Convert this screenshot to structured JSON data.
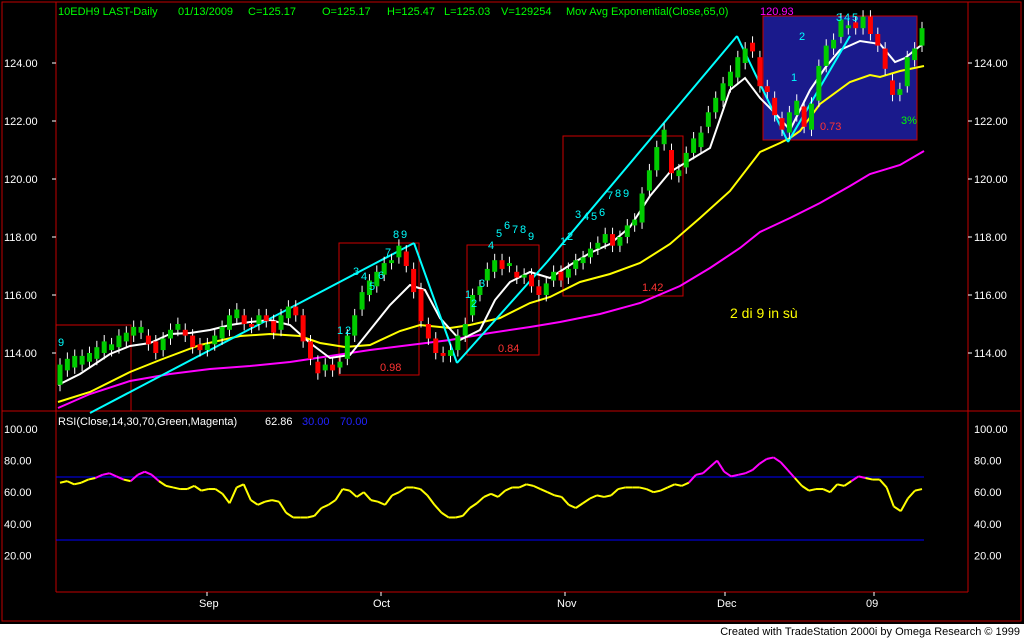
{
  "header": {
    "symbol": "10EDH9 LAST-Daily",
    "date": "01/13/2009",
    "close": "C=125.17",
    "open": "O=125.17",
    "high": "H=125.47",
    "low": "L=125.03",
    "volume": "V=129254",
    "ma_label": "Mov Avg Exponential(Close,65,0)",
    "ma_value": "120.93"
  },
  "rsi_header": {
    "label": "RSI(Close,14,30,70,Green,Magenta)",
    "value": "62.86",
    "low": "30.00",
    "high": "70.00"
  },
  "credit": "Created with TradeStation 2000i by Omega Research © 1999",
  "annotation": "2 di 9 in sù",
  "colors": {
    "background": "#000000",
    "up_candle": "#00cc00",
    "down_candle": "#ff0000",
    "ma_fast": "#ffffff",
    "ma_mid": "#ffff00",
    "ma_slow": "#ff00ff",
    "trendline": "#00ffff",
    "box": "#cc0000",
    "highlight_box": "#1a1a8c",
    "rsi_line": "#ffff00",
    "rsi_overbought": "#ff00ff",
    "ref_line": "#0000ff",
    "axis_text": "#ffffff",
    "header_green": "#00ff00",
    "header_red": "#ff3333"
  },
  "count_labels": [
    "1",
    "2",
    "3",
    "4",
    "5",
    "6",
    "7",
    "8",
    "9"
  ],
  "box_values": [
    "0.98",
    "0.84",
    "1.42",
    "0.73"
  ],
  "percent_label": "3%",
  "chart_data": [
    {
      "type": "candlestick",
      "title": "10EDH9 LAST-Daily",
      "x_tick_labels": [
        "Sep",
        "Oct",
        "Nov",
        "Dec",
        "09"
      ],
      "y_tick_labels": [
        "114.00",
        "116.00",
        "118.00",
        "120.00",
        "122.00",
        "124.00"
      ],
      "ylim": [
        112.0,
        125.8
      ],
      "grid": false,
      "bars_approx": [
        [
          112.9,
          113.6
        ],
        [
          113.4,
          113.8
        ],
        [
          113.5,
          113.9
        ],
        [
          113.6,
          113.9
        ],
        [
          113.7,
          114.0
        ],
        [
          113.8,
          114.2
        ],
        [
          114.0,
          114.4
        ],
        [
          114.1,
          114.3
        ],
        [
          114.2,
          114.6
        ],
        [
          114.4,
          114.7
        ],
        [
          114.6,
          114.9
        ],
        [
          114.7,
          114.9
        ],
        [
          114.6,
          114.3
        ],
        [
          114.4,
          114.0
        ],
        [
          114.1,
          114.5
        ],
        [
          114.5,
          114.8
        ],
        [
          114.8,
          115.0
        ],
        [
          114.8,
          114.6
        ],
        [
          114.6,
          114.2
        ],
        [
          114.3,
          114.1
        ],
        [
          114.1,
          114.3
        ],
        [
          114.3,
          114.6
        ],
        [
          114.5,
          114.9
        ],
        [
          114.8,
          115.3
        ],
        [
          115.2,
          115.5
        ],
        [
          115.3,
          115.0
        ],
        [
          115.0,
          114.9
        ],
        [
          115.0,
          115.3
        ],
        [
          115.3,
          115.1
        ],
        [
          115.1,
          114.7
        ],
        [
          114.8,
          115.3
        ],
        [
          115.2,
          115.6
        ],
        [
          115.6,
          115.3
        ],
        [
          115.3,
          114.4
        ],
        [
          114.4,
          113.8
        ],
        [
          113.7,
          113.3
        ],
        [
          113.4,
          113.6
        ],
        [
          113.6,
          113.4
        ],
        [
          113.5,
          113.7
        ],
        [
          113.8,
          114.6
        ],
        [
          114.6,
          115.3
        ],
        [
          115.5,
          116.1
        ],
        [
          116.0,
          116.5
        ],
        [
          116.3,
          116.8
        ],
        [
          116.7,
          117.1
        ],
        [
          117.1,
          117.2
        ],
        [
          117.3,
          117.7
        ],
        [
          117.5,
          117.0
        ],
        [
          116.9,
          116.1
        ],
        [
          116.2,
          115.1
        ],
        [
          115.0,
          114.5
        ],
        [
          114.5,
          114.0
        ],
        [
          114.0,
          113.9
        ],
        [
          113.9,
          114.1
        ],
        [
          114.1,
          114.6
        ],
        [
          114.6,
          115.0
        ],
        [
          115.3,
          116.0
        ],
        [
          116.0,
          116.3
        ],
        [
          116.5,
          116.9
        ],
        [
          116.8,
          117.2
        ],
        [
          117.2,
          116.9
        ],
        [
          117.0,
          117.1
        ],
        [
          116.8,
          116.6
        ],
        [
          116.6,
          116.7
        ],
        [
          116.7,
          116.3
        ],
        [
          116.3,
          116.0
        ],
        [
          116.0,
          116.4
        ],
        [
          116.5,
          116.8
        ],
        [
          116.8,
          116.5
        ],
        [
          116.6,
          116.9
        ],
        [
          116.9,
          117.2
        ],
        [
          117.1,
          117.3
        ],
        [
          117.3,
          117.6
        ],
        [
          117.6,
          117.8
        ],
        [
          117.8,
          118.1
        ],
        [
          118.1,
          117.7
        ],
        [
          117.7,
          118.0
        ],
        [
          118.0,
          118.4
        ],
        [
          118.4,
          118.6
        ],
        [
          118.5,
          119.5
        ],
        [
          119.6,
          120.3
        ],
        [
          120.3,
          121.1
        ],
        [
          121.2,
          121.7
        ],
        [
          121.0,
          120.2
        ],
        [
          120.1,
          120.3
        ],
        [
          120.4,
          120.9
        ],
        [
          120.9,
          121.4
        ],
        [
          121.1,
          121.6
        ],
        [
          121.8,
          122.3
        ],
        [
          122.3,
          122.8
        ],
        [
          122.7,
          123.3
        ],
        [
          123.2,
          123.7
        ],
        [
          123.5,
          124.2
        ],
        [
          124.0,
          124.5
        ],
        [
          124.7,
          124.4
        ],
        [
          124.2,
          123.2
        ],
        [
          123.2,
          123.0
        ],
        [
          122.8,
          122.2
        ],
        [
          122.1,
          121.7
        ],
        [
          121.6,
          122.3
        ],
        [
          122.2,
          122.7
        ],
        [
          122.5,
          121.8
        ],
        [
          121.7,
          122.6
        ],
        [
          122.7,
          123.9
        ],
        [
          123.9,
          124.6
        ],
        [
          124.5,
          124.8
        ],
        [
          124.9,
          125.5
        ],
        [
          125.2,
          125.3
        ],
        [
          125.4,
          125.2
        ],
        [
          125.2,
          125.6
        ],
        [
          125.6,
          125.0
        ],
        [
          125.0,
          124.6
        ],
        [
          124.5,
          123.8
        ],
        [
          123.4,
          122.9
        ],
        [
          122.9,
          123.1
        ],
        [
          123.2,
          124.2
        ],
        [
          124.1,
          124.5
        ],
        [
          124.6,
          125.2
        ]
      ]
    },
    {
      "type": "line",
      "title": "RSI(Close,14,30,70,Green,Magenta)",
      "y_tick_labels": [
        "20.00",
        "40.00",
        "60.00",
        "80.00",
        "100.00"
      ],
      "ylim": [
        10,
        105
      ],
      "reference_lines": [
        30,
        70
      ],
      "values_approx": [
        66,
        67,
        65,
        66,
        68,
        69,
        71,
        72,
        70,
        68,
        67,
        71,
        73,
        71,
        67,
        64,
        63,
        62,
        62,
        64,
        61,
        62,
        62,
        59,
        53,
        63,
        65,
        55,
        52,
        54,
        55,
        54,
        47,
        44,
        44,
        44,
        45,
        50,
        52,
        55,
        62,
        61,
        57,
        60,
        55,
        54,
        52,
        58,
        60,
        63,
        63,
        62,
        58,
        52,
        47,
        44,
        44,
        45,
        50,
        53,
        57,
        59,
        57,
        61,
        63,
        63,
        65,
        64,
        62,
        60,
        58,
        57,
        52,
        50,
        53,
        56,
        58,
        57,
        58,
        62,
        63,
        63,
        63,
        62,
        60,
        61,
        63,
        65,
        64,
        66,
        71,
        72,
        76,
        80,
        73,
        70,
        71,
        72,
        74,
        78,
        81,
        82,
        79,
        74,
        69,
        64,
        61,
        62,
        62,
        60,
        65,
        64,
        67,
        70,
        69,
        68,
        68,
        63,
        51,
        48,
        56,
        61,
        62
      ],
      "values_y_convention": "0-100 RSI"
    }
  ]
}
